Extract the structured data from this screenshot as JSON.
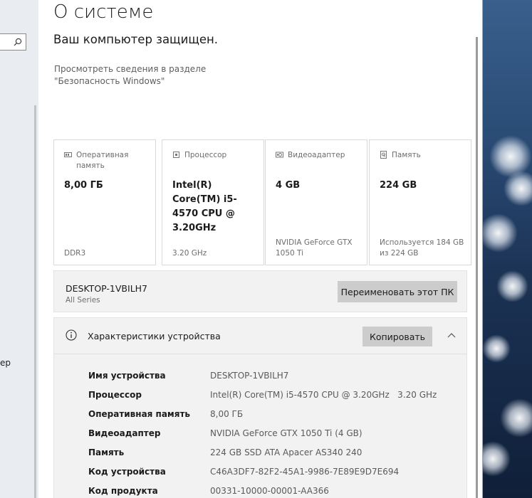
{
  "sidebar": {
    "cut_label": "ер"
  },
  "page": {
    "title": "О системе",
    "protected_text": "Ваш компьютер защищен.",
    "security_link": "Просмотреть сведения в разделе \"Безопасность Windows\""
  },
  "cards": [
    {
      "icon": "memory-icon",
      "label": "Оперативная память",
      "value": "8,00 ГБ",
      "sub": "DDR3"
    },
    {
      "icon": "processor-icon",
      "label": "Процессор",
      "value": "Intel(R) Core(TM) i5-4570 CPU @ 3.20GHz",
      "sub": "3.20 GHz"
    },
    {
      "icon": "video-adapter-icon",
      "label": "Видеоадаптер",
      "value": "4 GB",
      "sub": "NVIDIA GeForce GTX 1050 Ti"
    },
    {
      "icon": "storage-icon",
      "label": "Память",
      "value": "224 GB",
      "sub": "Используется 184 GB из 224 GB"
    }
  ],
  "pc": {
    "name": "DESKTOP-1VBILH7",
    "model": "All Series",
    "rename_label": "Переименовать этот ПК"
  },
  "specs": {
    "title": "Характеристики устройства",
    "copy_label": "Копировать",
    "rows": [
      {
        "key": "Имя устройства",
        "value": "DESKTOP-1VBILH7"
      },
      {
        "key": "Процессор",
        "value": "Intel(R) Core(TM) i5-4570 CPU @ 3.20GHz   3.20 GHz"
      },
      {
        "key": "Оперативная память",
        "value": "8,00 ГБ"
      },
      {
        "key": "Видеоадаптер",
        "value": "NVIDIA GeForce GTX 1050 Ti (4 GB)"
      },
      {
        "key": "Память",
        "value": "224 GB SSD ATA Apacer AS340 240"
      },
      {
        "key": "Код устройства",
        "value": "C46A3DF7-82F2-45A1-9986-7E89E9D7E694"
      },
      {
        "key": "Код продукта",
        "value": "00331-10000-00001-AA366"
      }
    ]
  },
  "colors": {
    "button_bg": "#cccccc",
    "panel_bg": "#f2f2f2",
    "text_primary": "#1b1b1b",
    "text_secondary": "#6d6d6d"
  }
}
